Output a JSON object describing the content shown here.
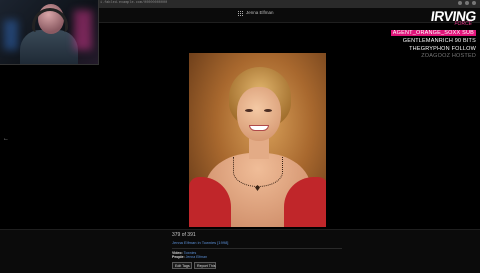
{
  "browser": {
    "url": "i.fabled.example.com/00000000000"
  },
  "album": {
    "title": "Jenna Elfman"
  },
  "viewer": {
    "counter": "379 of 391",
    "caption": "Jenna Elfman in Townies [1998]",
    "meta": [
      {
        "label": "Video:",
        "value": "Townies"
      },
      {
        "label": "People:",
        "value": "Jenna Elfman"
      }
    ],
    "buttons": {
      "edit": "Edit Tags",
      "report": "Report This"
    }
  },
  "stream_overlay": {
    "logo": "IRVING",
    "logo_sub": "FORCE",
    "alerts": [
      "AGENT_ORANGE_SOXX SUB",
      "GENTLEMANRICH 90 BITS",
      "THEGRYPHON FOLLOW",
      "ZOAGOOZ HOSTED"
    ]
  },
  "colors": {
    "highlight": "#e0157a",
    "link": "#5b8fd6",
    "photo_top": "#c0262a"
  },
  "icons": [
    "grid-icon",
    "back-arrow-icon"
  ]
}
